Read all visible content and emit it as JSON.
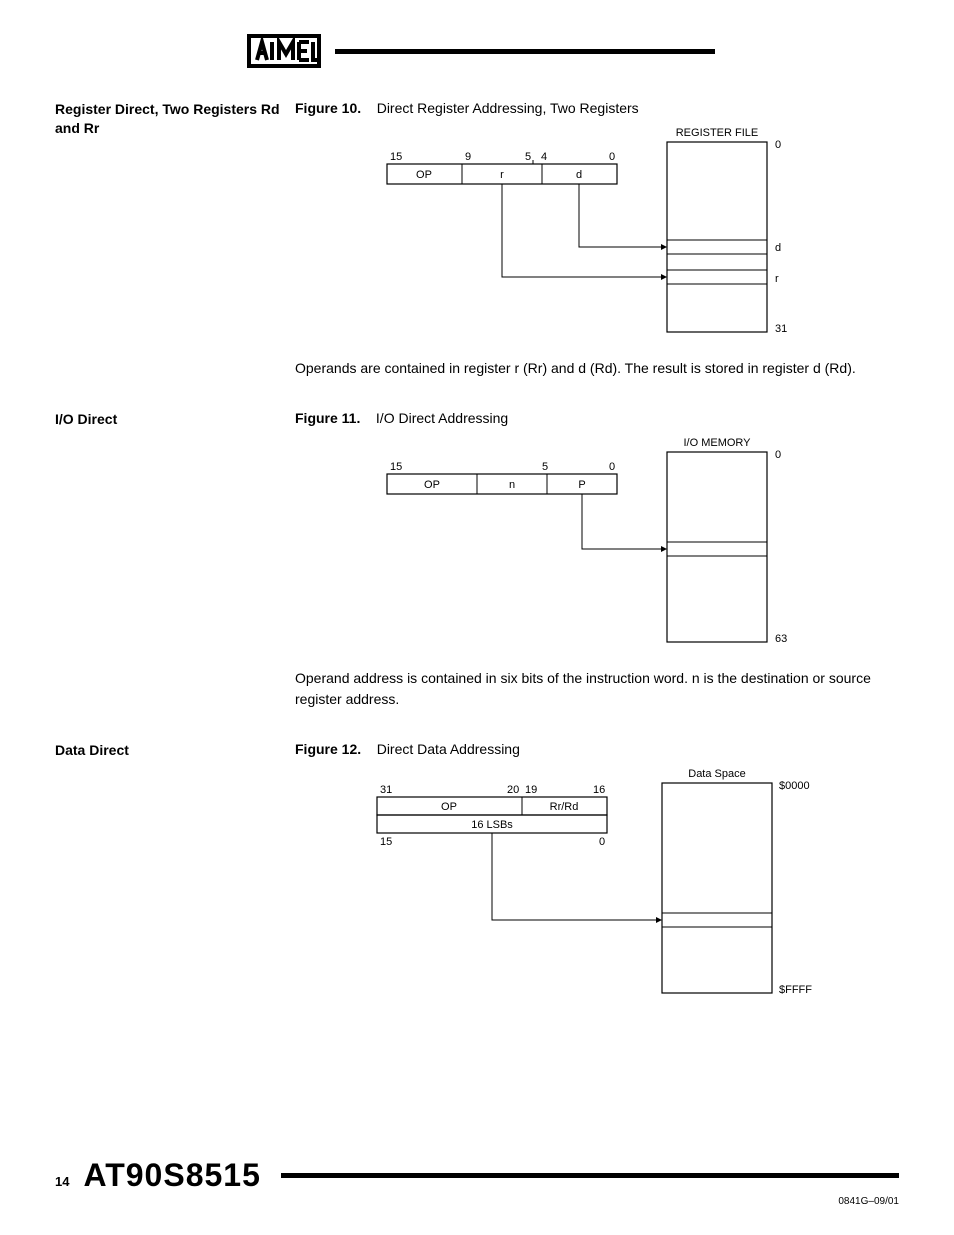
{
  "header": {
    "logo_name": "atmel-logo"
  },
  "section1": {
    "heading": "Register Direct, Two Registers Rd and Rr",
    "fig_label": "Figure 10.",
    "fig_title": "Direct Register Addressing, Two Registers",
    "diagram": {
      "reg_title": "REGISTER FILE",
      "bits": {
        "b15": "15",
        "b9": "9",
        "b5": "5",
        "b4": "4",
        "b0": "0"
      },
      "fields": {
        "op": "OP",
        "r": "r",
        "d": "d"
      },
      "marks": {
        "top": "0",
        "d": "d",
        "r": "r",
        "bot": "31"
      }
    },
    "body": "Operands are contained in register r (Rr) and d (Rd). The result is stored in register d (Rd)."
  },
  "section2": {
    "heading": "I/O Direct",
    "fig_label": "Figure 11.",
    "fig_title": "I/O Direct Addressing",
    "diagram": {
      "mem_title": "I/O MEMORY",
      "bits": {
        "b15": "15",
        "b5": "5",
        "b0": "0"
      },
      "fields": {
        "op": "OP",
        "n": "n",
        "p": "P"
      },
      "marks": {
        "top": "0",
        "bot": "63"
      }
    },
    "body": "Operand address is contained in six bits of the instruction word. n is the destination or source register address."
  },
  "section3": {
    "heading": "Data Direct",
    "fig_label": "Figure 12.",
    "fig_title": "Direct Data Addressing",
    "diagram": {
      "space_title": "Data Space",
      "bits": {
        "b31": "31",
        "b20": "20",
        "b19": "19",
        "b16": "16",
        "b15": "15",
        "b0": "0"
      },
      "fields": {
        "op": "OP",
        "rrrd": "Rr/Rd",
        "lsbs": "16 LSBs"
      },
      "marks": {
        "top": "$0000",
        "bot": "$FFFF"
      }
    }
  },
  "footer": {
    "page": "14",
    "product": "AT90S8515",
    "rev": "0841G–09/01"
  }
}
